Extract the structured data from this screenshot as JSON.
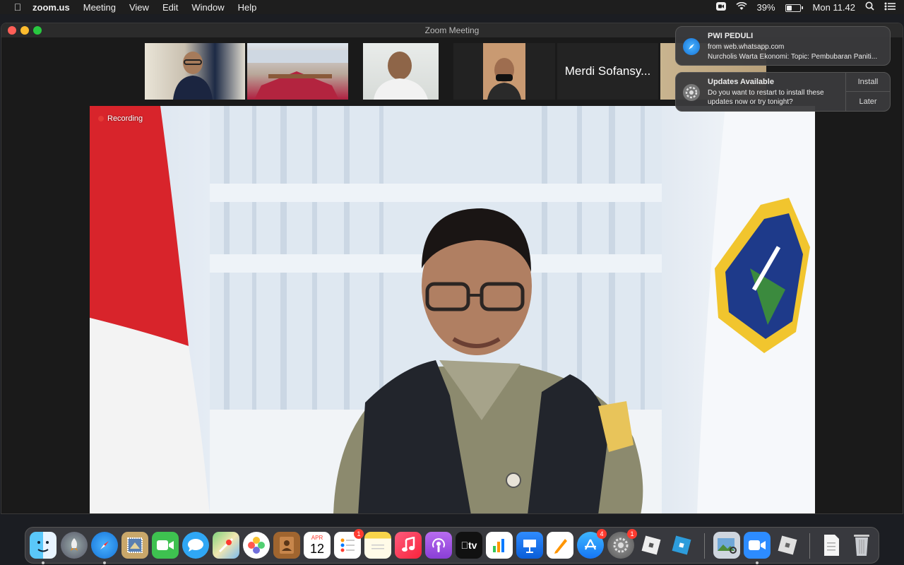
{
  "menubar": {
    "app_name": "zoom.us",
    "items": [
      "Meeting",
      "View",
      "Edit",
      "Window",
      "Help"
    ],
    "battery": "39%",
    "battery_level": 0.39,
    "clock": "Mon 11.42"
  },
  "window": {
    "title": "Zoom Meeting",
    "recording_label": "Recording",
    "participant_name_tile": "Merdi Sofansy..."
  },
  "notifications": [
    {
      "title": "PWI PEDULI",
      "line1": "from web.whatsapp.com",
      "line2": "Nurcholis Warta Ekonomi: Topic: Pembubaran Paniti..."
    },
    {
      "title": "Updates Available",
      "line1": "Do you want to restart to install these",
      "line2": "updates now or try tonight?",
      "action_install": "Install",
      "action_later": "Later"
    }
  ],
  "dock": {
    "calendar_month": "APR",
    "calendar_day": "12",
    "reminders_badge": "1",
    "appstore_badge": "4",
    "settings_badge": "1",
    "appletv_label": "tv"
  },
  "colors": {
    "recording_dot": "#e53935",
    "zoom_blue": "#2d8cff",
    "badge_red": "#ff3b30"
  }
}
